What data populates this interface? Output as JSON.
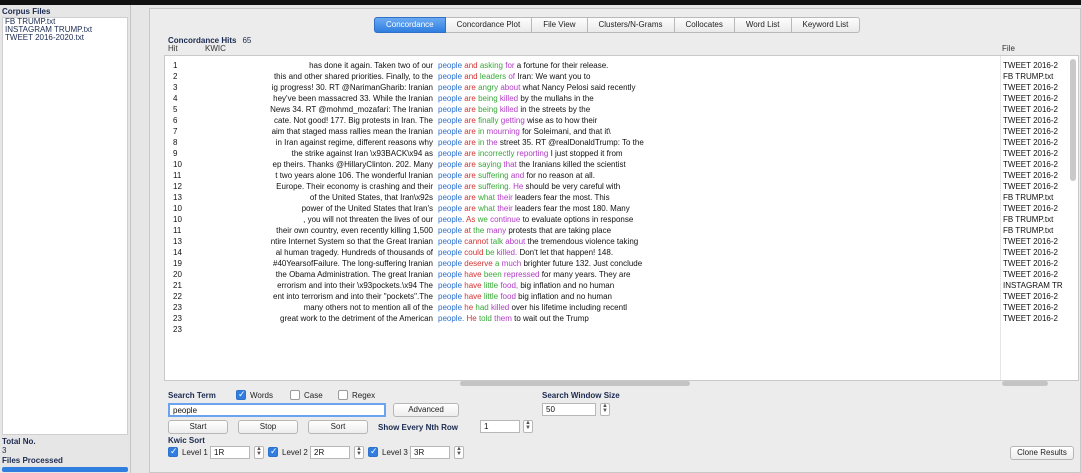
{
  "left_panel": {
    "title": "Corpus Files",
    "files": [
      "FB TRUMP.txt",
      "INSTAGRAM TRUMP.txt",
      "TWEET 2016-2020.txt"
    ],
    "total_label": "Total No.",
    "total_value": "3",
    "processed_label": "Files Processed",
    "processed_fraction": 1.0
  },
  "tabs": [
    {
      "label": "Concordance",
      "active": true
    },
    {
      "label": "Concordance Plot",
      "active": false
    },
    {
      "label": "File View",
      "active": false
    },
    {
      "label": "Clusters/N-Grams",
      "active": false
    },
    {
      "label": "Collocates",
      "active": false
    },
    {
      "label": "Word List",
      "active": false
    },
    {
      "label": "Keyword List",
      "active": false
    }
  ],
  "hits": {
    "label": "Concordance Hits",
    "count": "65"
  },
  "columns": {
    "hit": "Hit",
    "kwic": "KWIC",
    "file": "File"
  },
  "rows": [
    {
      "hit": "1",
      "left": "has done it again. Taken two of our",
      "kw": "people",
      "r1": "and",
      "r2": "asking",
      "r3": "for",
      "rest": "a fortune for their release.",
      "file": "TWEET 2016-2"
    },
    {
      "hit": "2",
      "left": "this and other shared priorities. Finally, to the",
      "kw": "people",
      "r1": "and",
      "r2": "leaders",
      "r3": "of",
      "rest": "Iran: We want you to",
      "file": "FB TRUMP.txt"
    },
    {
      "hit": "3",
      "left": "ig progress! 30. RT @NarimanGharib: Iranian",
      "kw": "people",
      "r1": "are",
      "r2": "angry",
      "r3": "about",
      "rest": "what Nancy Pelosi said recently",
      "file": "TWEET 2016-2"
    },
    {
      "hit": "4",
      "left": "hey've been massacred 33. While the Iranian",
      "kw": "people",
      "r1": "are",
      "r2": "being",
      "r3": "killed",
      "rest": "by the mullahs in the",
      "file": "TWEET 2016-2"
    },
    {
      "hit": "5",
      "left": "News 34. RT @mohmd_mozafari: The Iranian",
      "kw": "people",
      "r1": "are",
      "r2": "being",
      "r3": "killed",
      "rest": "in the streets by the",
      "file": "TWEET 2016-2"
    },
    {
      "hit": "6",
      "left": "cate. Not good! 177. Big protests in Iran. The",
      "kw": "people",
      "r1": "are",
      "r2": "finally",
      "r3": "getting",
      "rest": "wise as to how their",
      "file": "TWEET 2016-2"
    },
    {
      "hit": "7",
      "left": "aim that staged mass rallies mean the Iranian",
      "kw": "people",
      "r1": "are",
      "r2": "in",
      "r3": "mourning",
      "rest": "for Soleimani, and that it\\",
      "file": "TWEET 2016-2"
    },
    {
      "hit": "8",
      "left": "in Iran against regime, different reasons why",
      "kw": "people",
      "r1": "are",
      "r2": "in",
      "r3": "the",
      "rest": "street 35. RT @realDonaldTrump: To the",
      "file": "TWEET 2016-2"
    },
    {
      "hit": "9",
      "left": "the strike against Iran \\x93BACK\\x94 as",
      "kw": "people",
      "r1": "are",
      "r2": "incorrectly",
      "r3": "reporting",
      "rest": "I just stopped it from",
      "file": "TWEET 2016-2"
    },
    {
      "hit": "10",
      "left": "ep theirs. Thanks @HillaryClinton. 202. Many",
      "kw": "people",
      "r1": "are",
      "r2": "saying",
      "r3": "that",
      "rest": "the Iranians killed the scientist",
      "file": "TWEET 2016-2"
    },
    {
      "hit": "11",
      "left": "t two years alone 106. The wonderful Iranian",
      "kw": "people",
      "r1": "are",
      "r2": "suffering",
      "r3": "and",
      "rest": "for no reason at all.",
      "file": "TWEET 2016-2"
    },
    {
      "hit": "12",
      "left": "Europe. Their economy is crashing and their",
      "kw": "people",
      "r1": "are",
      "r2": "suffering.",
      "r3": "He",
      "rest": "should be very careful with",
      "file": "TWEET 2016-2"
    },
    {
      "hit": "13",
      "left": "of the United States, that Iran\\x92s",
      "kw": "people",
      "r1": "are",
      "r2": "what",
      "r3": "their",
      "rest": "leaders fear the most. This",
      "file": "FB TRUMP.txt"
    },
    {
      "hit": "10",
      "left": "power of the United States that Iran's",
      "kw": "people",
      "r1": "are",
      "r2": "what",
      "r3": "their",
      "rest": "leaders fear the most 180. Many",
      "file": "TWEET 2016-2"
    },
    {
      "hit": "10",
      "left": ", you will not threaten the lives of our",
      "kw": "people.",
      "r1": "As",
      "r2": "we",
      "r3": "continue",
      "rest": "to evaluate options in response",
      "file": "FB TRUMP.txt"
    },
    {
      "hit": "11",
      "left": "their own country, even recently killing 1,500",
      "kw": "people",
      "r1": "at",
      "r2": "the",
      "r3": "many",
      "rest": "protests that are taking place",
      "file": "FB TRUMP.txt"
    },
    {
      "hit": "13",
      "left": "ntire Internet System so that the Great Iranian",
      "kw": "people",
      "r1": "cannot",
      "r2": "talk",
      "r3": "about",
      "rest": "the tremendous violence taking",
      "file": "TWEET 2016-2"
    },
    {
      "hit": "14",
      "left": "al human tragedy. Hundreds of thousands of",
      "kw": "people",
      "r1": "could",
      "r2": "be",
      "r3": "killed.",
      "rest": "Don't let that happen! 148.",
      "file": "TWEET 2016-2"
    },
    {
      "hit": "19",
      "left": "#40YearsofFailure. The long-suffering Iranian",
      "kw": "people",
      "r1": "deserve",
      "r2": "a",
      "r3": "much",
      "rest": "brighter future 132. Just conclude",
      "file": "TWEET 2016-2"
    },
    {
      "hit": "20",
      "left": "the Obama Administration. The great Iranian",
      "kw": "people",
      "r1": "have",
      "r2": "been",
      "r3": "repressed",
      "rest": "for many years. They are",
      "file": "TWEET 2016-2"
    },
    {
      "hit": "21",
      "left": "errorism and into their \\x93pockets.\\x94 The",
      "kw": "people",
      "r1": "have",
      "r2": "little",
      "r3": "food,",
      "rest": "big inflation and no human",
      "file": "INSTAGRAM TR"
    },
    {
      "hit": "22",
      "left": "ent into terrorism and into their \"pockets\".The",
      "kw": "people",
      "r1": "have",
      "r2": "little",
      "r3": "food",
      "rest": "big inflation and no human",
      "file": "TWEET 2016-2"
    },
    {
      "hit": "23",
      "left": "many others not to mention all of the",
      "kw": "people",
      "r1": "he",
      "r2": "had",
      "r3": "killed",
      "rest": "over his lifetime including recentl",
      "file": "TWEET 2016-2"
    },
    {
      "hit": "23",
      "left": "great work to the detriment of the American",
      "kw": "people.",
      "r1": "He",
      "r2": "told",
      "r3": "them",
      "rest": "to wait out the Trump",
      "file": "TWEET 2016-2"
    },
    {
      "hit": "23",
      "left": "",
      "kw": "",
      "r1": "",
      "r2": "",
      "r3": "",
      "rest": "",
      "file": ""
    }
  ],
  "controls": {
    "search_term_label": "Search Term",
    "words_label": "Words",
    "words_checked": true,
    "case_label": "Case",
    "case_checked": false,
    "regex_label": "Regex",
    "regex_checked": false,
    "search_value": "people",
    "advanced_label": "Advanced",
    "search_window_label": "Search Window Size",
    "search_window_value": "50",
    "start_label": "Start",
    "stop_label": "Stop",
    "sort_label": "Sort",
    "show_every_label": "Show Every Nth Row",
    "show_every_value": "1",
    "kwic_sort_label": "Kwic Sort",
    "level1_label": "Level 1",
    "level1_value": "1R",
    "level2_label": "Level 2",
    "level2_value": "2R",
    "level3_label": "Level 3",
    "level3_value": "3R",
    "clone_results_label": "Clone Results"
  },
  "colors": {
    "keyword": "#2a6fd0",
    "r1": "#d23232",
    "r2": "#37a837",
    "r3": "#b239c7",
    "active_tab": "#2f7ee0"
  }
}
